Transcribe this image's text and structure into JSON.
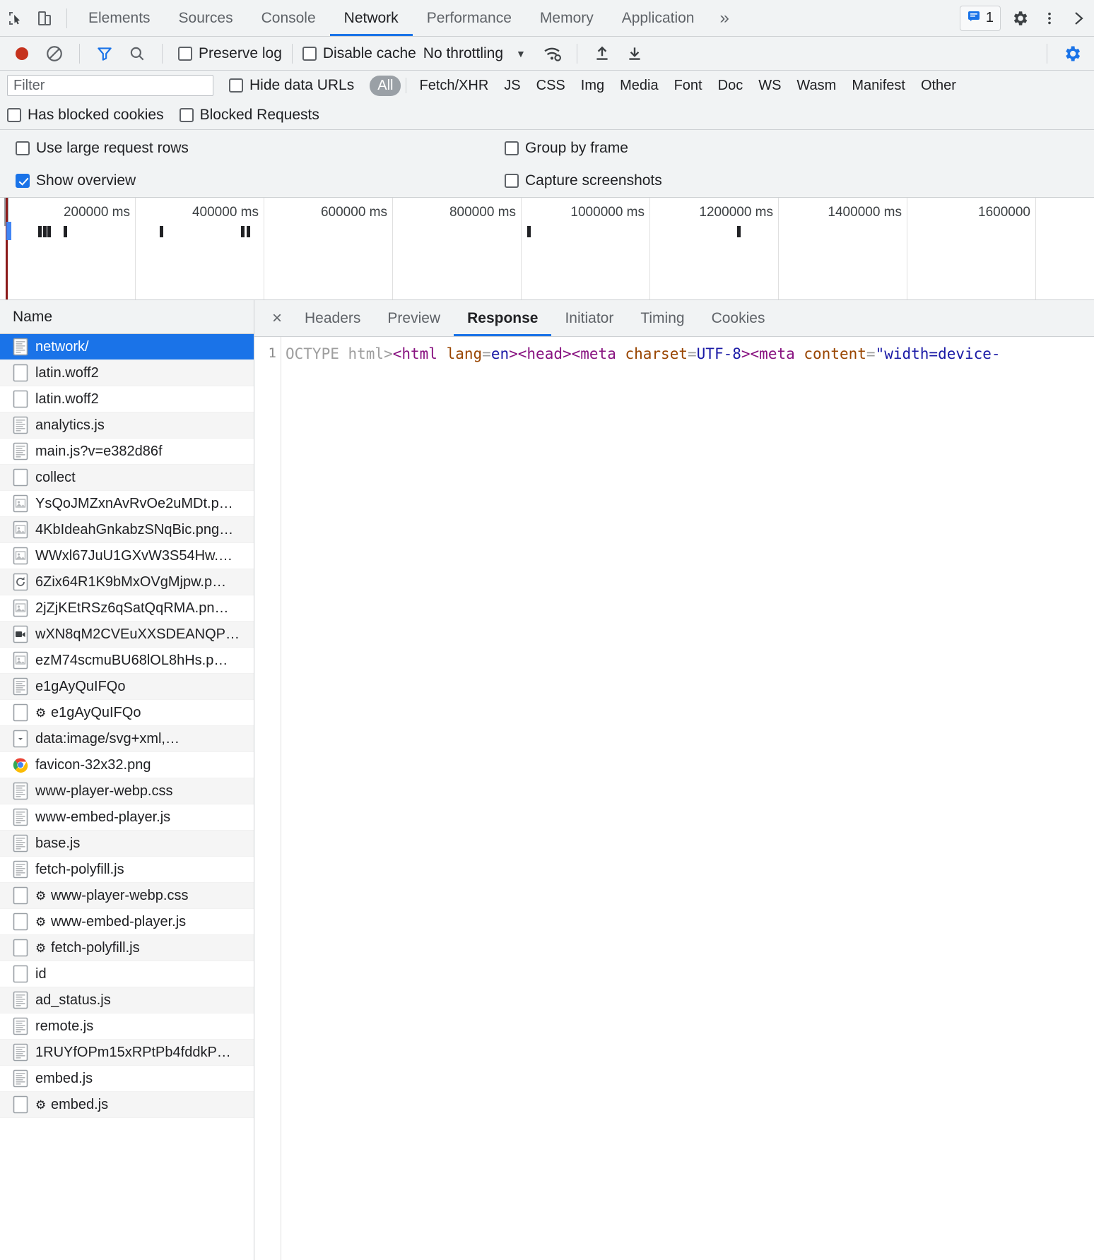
{
  "maintabs": {
    "inspect_icon": "inspect-cursor-icon",
    "device_icon": "device-toolbar-icon",
    "items": [
      {
        "label": "Elements",
        "active": false
      },
      {
        "label": "Sources",
        "active": false
      },
      {
        "label": "Console",
        "active": false
      },
      {
        "label": "Network",
        "active": true
      },
      {
        "label": "Performance",
        "active": false
      },
      {
        "label": "Memory",
        "active": false
      },
      {
        "label": "Application",
        "active": false
      }
    ],
    "more_label": "»",
    "issues_count": "1",
    "settings_icon": "gear-icon",
    "kebab_icon": "more-vertical-icon",
    "dock_icon": "close-icon"
  },
  "controlbar": {
    "record_icon": "record-stop-icon",
    "clear_icon": "clear-icon",
    "filter_icon": "filter-funnel-icon",
    "search_icon": "search-icon",
    "preserve_log": {
      "label": "Preserve log",
      "checked": false
    },
    "disable_cache": {
      "label": "Disable cache",
      "checked": false
    },
    "throttling": "No throttling",
    "throttle_caret": "▼",
    "wifi_icon": "network-conditions-icon",
    "import_icon": "import-har-icon",
    "export_icon": "export-har-icon",
    "settings_icon": "network-settings-gear-icon"
  },
  "filterbar": {
    "placeholder": "Filter",
    "value": "",
    "hide_data_urls": {
      "label": "Hide data URLs",
      "checked": false
    },
    "types": [
      {
        "label": "All",
        "selected": true
      },
      {
        "label": "Fetch/XHR",
        "selected": false
      },
      {
        "label": "JS",
        "selected": false
      },
      {
        "label": "CSS",
        "selected": false
      },
      {
        "label": "Img",
        "selected": false
      },
      {
        "label": "Media",
        "selected": false
      },
      {
        "label": "Font",
        "selected": false
      },
      {
        "label": "Doc",
        "selected": false
      },
      {
        "label": "WS",
        "selected": false
      },
      {
        "label": "Wasm",
        "selected": false
      },
      {
        "label": "Manifest",
        "selected": false
      },
      {
        "label": "Other",
        "selected": false
      }
    ],
    "has_blocked_cookies": {
      "label": "Has blocked cookies",
      "checked": false
    },
    "blocked_requests": {
      "label": "Blocked Requests",
      "checked": false
    }
  },
  "settings": {
    "use_large_request_rows": {
      "label": "Use large request rows",
      "checked": false
    },
    "show_overview": {
      "label": "Show overview",
      "checked": true
    },
    "group_by_frame": {
      "label": "Group by frame",
      "checked": false
    },
    "capture_screenshots": {
      "label": "Capture screenshots",
      "checked": false
    }
  },
  "overview": {
    "ticks": [
      "200000 ms",
      "400000 ms",
      "600000 ms",
      "800000 ms",
      "1000000 ms",
      "1200000 ms",
      "1400000 ms",
      "1600000"
    ],
    "dclevent_color": "#8b1a1a",
    "loadevent_color": "#4285f4",
    "bars": [
      48,
      56,
      63,
      88,
      237,
      364,
      372,
      809,
      1135
    ]
  },
  "requests": {
    "column_header": "Name",
    "rows": [
      {
        "name": "network/",
        "icon": "document-icon",
        "selected": true,
        "worker": false
      },
      {
        "name": "latin.woff2",
        "icon": "blank-icon",
        "selected": false,
        "worker": false
      },
      {
        "name": "latin.woff2",
        "icon": "blank-icon",
        "selected": false,
        "worker": false
      },
      {
        "name": "analytics.js",
        "icon": "script-icon",
        "selected": false,
        "worker": false
      },
      {
        "name": "main.js?v=e382d86f",
        "icon": "script-icon",
        "selected": false,
        "worker": false
      },
      {
        "name": "collect",
        "icon": "blank-icon",
        "selected": false,
        "worker": false
      },
      {
        "name": "YsQoJMZxnAvRvOe2uMDt.p…",
        "icon": "image-icon",
        "selected": false,
        "worker": false
      },
      {
        "name": "4KbIdeahGnkabzSNqBic.png…",
        "icon": "image-icon",
        "selected": false,
        "worker": false
      },
      {
        "name": "WWxl67JuU1GXvW3S54Hw.…",
        "icon": "image-icon",
        "selected": false,
        "worker": false
      },
      {
        "name": "6Zix64R1K9bMxOVgMjpw.p…",
        "icon": "pending-icon",
        "selected": false,
        "worker": false
      },
      {
        "name": "2jZjKEtRSz6qSatQqRMA.pn…",
        "icon": "image-icon",
        "selected": false,
        "worker": false
      },
      {
        "name": "wXN8qM2CVEuXXSDEANQP…",
        "icon": "media-icon",
        "selected": false,
        "worker": false
      },
      {
        "name": "ezM74scmuBU68lOL8hHs.p…",
        "icon": "image-icon",
        "selected": false,
        "worker": false
      },
      {
        "name": "e1gAyQuIFQo",
        "icon": "document-icon",
        "selected": false,
        "worker": false
      },
      {
        "name": "e1gAyQuIFQo",
        "icon": "blank-icon",
        "selected": false,
        "worker": true
      },
      {
        "name": "data:image/svg+xml,…",
        "icon": "data-url-icon",
        "selected": false,
        "worker": false
      },
      {
        "name": "favicon-32x32.png",
        "icon": "chrome-favicon-icon",
        "selected": false,
        "worker": false
      },
      {
        "name": "www-player-webp.css",
        "icon": "stylesheet-icon",
        "selected": false,
        "worker": false
      },
      {
        "name": "www-embed-player.js",
        "icon": "script-icon",
        "selected": false,
        "worker": false
      },
      {
        "name": "base.js",
        "icon": "script-icon",
        "selected": false,
        "worker": false
      },
      {
        "name": "fetch-polyfill.js",
        "icon": "script-icon",
        "selected": false,
        "worker": false
      },
      {
        "name": "www-player-webp.css",
        "icon": "blank-icon",
        "selected": false,
        "worker": true
      },
      {
        "name": "www-embed-player.js",
        "icon": "blank-icon",
        "selected": false,
        "worker": true
      },
      {
        "name": "fetch-polyfill.js",
        "icon": "blank-icon",
        "selected": false,
        "worker": true
      },
      {
        "name": "id",
        "icon": "blank-icon",
        "selected": false,
        "worker": false
      },
      {
        "name": "ad_status.js",
        "icon": "script-icon",
        "selected": false,
        "worker": false
      },
      {
        "name": "remote.js",
        "icon": "script-icon",
        "selected": false,
        "worker": false
      },
      {
        "name": "1RUYfOPm15xRPtPb4fddkP…",
        "icon": "script-icon",
        "selected": false,
        "worker": false
      },
      {
        "name": "embed.js",
        "icon": "script-icon",
        "selected": false,
        "worker": false
      },
      {
        "name": "embed.js",
        "icon": "blank-icon",
        "selected": false,
        "worker": true
      }
    ]
  },
  "detail": {
    "close_label": "×",
    "tabs": [
      {
        "label": "Headers",
        "active": false
      },
      {
        "label": "Preview",
        "active": false
      },
      {
        "label": "Response",
        "active": true
      },
      {
        "label": "Initiator",
        "active": false
      },
      {
        "label": "Timing",
        "active": false
      },
      {
        "label": "Cookies",
        "active": false
      }
    ],
    "line_number": "1",
    "code_tokens": [
      {
        "text": "OCTYPE html>",
        "cls": "tk-gray"
      },
      {
        "text": "<html ",
        "cls": "tk-tag"
      },
      {
        "text": "lang",
        "cls": "tk-attr"
      },
      {
        "text": "=",
        "cls": "tk-gray"
      },
      {
        "text": "en",
        "cls": "tk-value"
      },
      {
        "text": ">",
        "cls": "tk-tag"
      },
      {
        "text": "<head>",
        "cls": "tk-tag"
      },
      {
        "text": "<meta ",
        "cls": "tk-tag"
      },
      {
        "text": "charset",
        "cls": "tk-attr"
      },
      {
        "text": "=",
        "cls": "tk-gray"
      },
      {
        "text": "UTF-8",
        "cls": "tk-value"
      },
      {
        "text": ">",
        "cls": "tk-tag"
      },
      {
        "text": "<meta ",
        "cls": "tk-tag"
      },
      {
        "text": "content",
        "cls": "tk-attr"
      },
      {
        "text": "=",
        "cls": "tk-gray"
      },
      {
        "text": "\"width=device-",
        "cls": "tk-value"
      }
    ]
  }
}
